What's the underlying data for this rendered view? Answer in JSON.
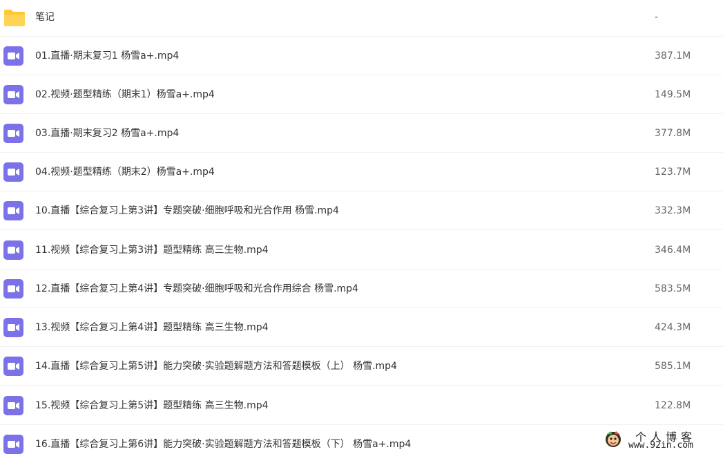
{
  "files": [
    {
      "type": "folder",
      "icon": "folder-icon",
      "name": "笔记",
      "size": "-"
    },
    {
      "type": "video",
      "icon": "video-file-icon",
      "name": "01.直播·期末复习1 杨雪a+.mp4",
      "size": "387.1M"
    },
    {
      "type": "video",
      "icon": "video-file-icon",
      "name": "02.视频·题型精练（期末1）杨雪a+.mp4",
      "size": "149.5M"
    },
    {
      "type": "video",
      "icon": "video-file-icon",
      "name": "03.直播·期末复习2 杨雪a+.mp4",
      "size": "377.8M"
    },
    {
      "type": "video",
      "icon": "video-file-icon",
      "name": "04.视频·题型精练（期末2）杨雪a+.mp4",
      "size": "123.7M"
    },
    {
      "type": "video",
      "icon": "video-file-icon",
      "name": "10.直播【综合复习上第3讲】专题突破·细胞呼吸和光合作用 杨雪.mp4",
      "size": "332.3M"
    },
    {
      "type": "video",
      "icon": "video-file-icon",
      "name": "11.视频【综合复习上第3讲】题型精练 高三生物.mp4",
      "size": "346.4M"
    },
    {
      "type": "video",
      "icon": "video-file-icon",
      "name": "12.直播【综合复习上第4讲】专题突破·细胞呼吸和光合作用综合 杨雪.mp4",
      "size": "583.5M"
    },
    {
      "type": "video",
      "icon": "video-file-icon",
      "name": "13.视频【综合复习上第4讲】题型精练 高三生物.mp4",
      "size": "424.3M"
    },
    {
      "type": "video",
      "icon": "video-file-icon",
      "name": "14.直播【综合复习上第5讲】能力突破·实验题解题方法和答题模板（上） 杨雪.mp4",
      "size": "585.1M"
    },
    {
      "type": "video",
      "icon": "video-file-icon",
      "name": "15.视频【综合复习上第5讲】题型精练 高三生物.mp4",
      "size": "122.8M"
    },
    {
      "type": "video",
      "icon": "video-file-icon",
      "name": "16.直播【综合复习上第6讲】能力突破·实验题解题方法和答题模板（下） 杨雪a+.mp4",
      "size": ""
    }
  ],
  "watermark": {
    "title": "个人博客",
    "url": "www.92in.com",
    "icon": "mascot-logo-icon"
  },
  "colors": {
    "folder": "#ffc833",
    "video": "#7b72e9",
    "text": "#333333",
    "size_text": "#666666",
    "divider": "#f0f0f2"
  }
}
